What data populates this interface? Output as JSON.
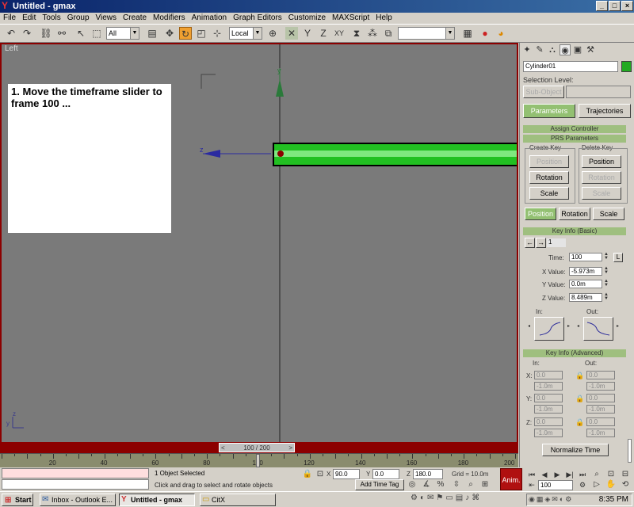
{
  "window": {
    "title": "Untitled - gmax",
    "min": "_",
    "restore": "□",
    "close": "×"
  },
  "menu": [
    "File",
    "Edit",
    "Tools",
    "Group",
    "Views",
    "Create",
    "Modifiers",
    "Animation",
    "Graph Editors",
    "Customize",
    "MAXScript",
    "Help"
  ],
  "toolbar": {
    "selection_filter": "All",
    "coord_system": "Local",
    "named_selection": ""
  },
  "viewport": {
    "label": "Left",
    "instruction": "1.  Move the timeframe slider to frame 100 ...",
    "axis_y": "y",
    "axis_z": "z"
  },
  "timeslider": {
    "label": "100 / 200",
    "prev": "<",
    "next": ">",
    "position_fraction": 0.5
  },
  "ruler": {
    "ticks": [
      "20",
      "40",
      "60",
      "80",
      "100",
      "120",
      "140",
      "160",
      "180",
      "200"
    ]
  },
  "status": {
    "selected": "1 Object Selected",
    "prompt": "Click and drag to select and rotate objects",
    "x_label": "X",
    "x": "90.0",
    "y_label": "Y",
    "y": "0.0",
    "z_label": "Z",
    "z": "180.0",
    "grid": "Grid = 10.0m",
    "add_time_tag": "Add Time Tag",
    "anim": "Anim.",
    "frame": "100"
  },
  "panel": {
    "object_name": "Cylinder01",
    "object_color": "#22aa22",
    "selection_level_label": "Selection Level:",
    "sub_object": "Sub-Object",
    "tab_parameters": "Parameters",
    "tab_trajectories": "Trajectories",
    "assign_controller": "Assign Controller",
    "prs_parameters": "PRS Parameters",
    "create_key": "Create Key",
    "delete_key": "Delete Key",
    "ck_position": "Position",
    "ck_rotation": "Rotation",
    "ck_scale": "Scale",
    "dk_position": "Position",
    "dk_rotation": "Rotation",
    "dk_scale": "Scale",
    "mode_position": "Position",
    "mode_rotation": "Rotation",
    "mode_scale": "Scale",
    "key_info_basic": "Key Info (Basic)",
    "key_number": "1",
    "time_label": "Time:",
    "time": "100",
    "lock": "L",
    "xval_label": "X Value:",
    "xval": "-5.973m",
    "yval_label": "Y Value:",
    "yval": "0.0m",
    "zval_label": "Z Value:",
    "zval": "8.489m",
    "in_label": "In:",
    "out_label": "Out:",
    "key_info_adv": "Key Info (Advanced)",
    "adv_in": "In:",
    "adv_out": "Out:",
    "adv_x": "X:",
    "adv_y": "Y:",
    "adv_z": "Z:",
    "adv_in_x": "0.0",
    "adv_in_x2": "-1.0m",
    "adv_out_x": "0.0",
    "adv_out_x2": "-1.0m",
    "adv_in_y": "0.0",
    "adv_in_y2": "-1.0m",
    "adv_out_y": "0.0",
    "adv_out_y2": "-1.0m",
    "adv_in_z": "0.0",
    "adv_in_z2": "-1.0m",
    "adv_out_z": "0.0",
    "adv_out_z2": "-1.0m",
    "normalize_time": "Normalize Time"
  },
  "taskbar": {
    "start": "Start",
    "tasks": [
      "Inbox - Outlook E...",
      "Untitled - gmax",
      "CitX"
    ],
    "clock": "8:35 PM"
  },
  "colors": {
    "viewport_border": "#8c0000",
    "accent_green": "#93c072",
    "cylinder": "#22c022"
  }
}
